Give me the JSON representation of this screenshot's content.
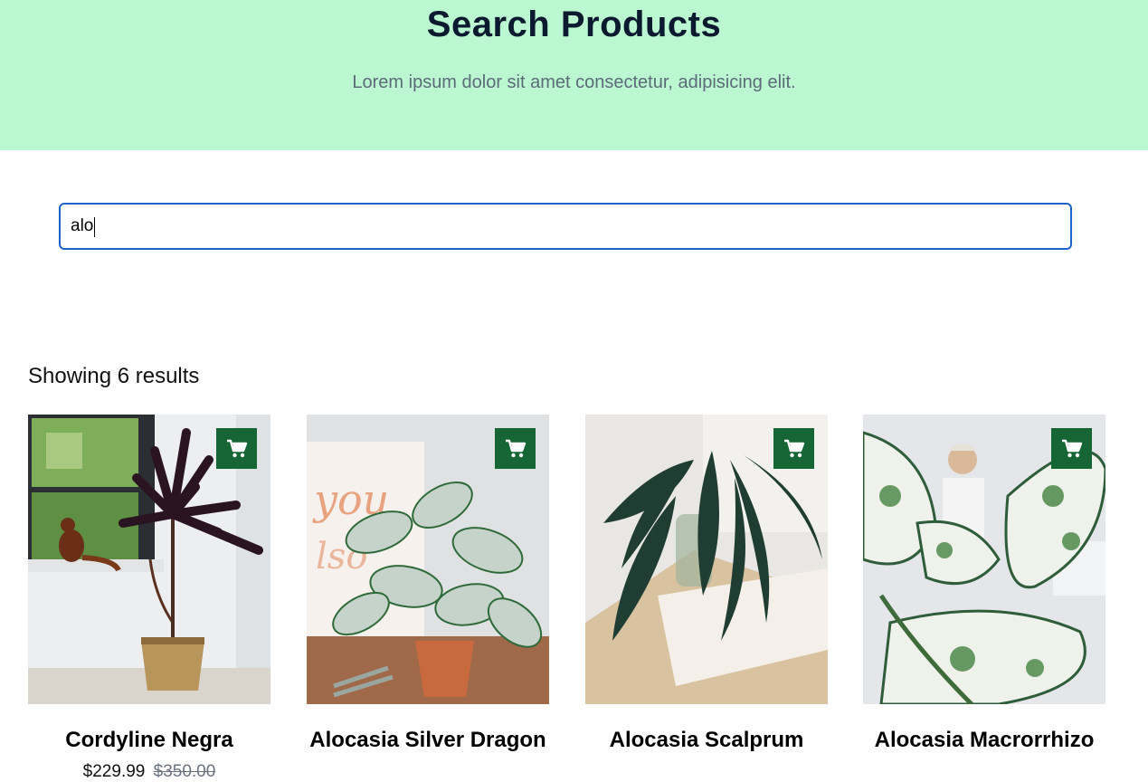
{
  "hero": {
    "title": "Search Products",
    "subtitle": "Lorem ipsum dolor sit amet consectetur, adipisicing elit."
  },
  "search": {
    "value": "alo"
  },
  "results": {
    "count_text": "Showing 6 results"
  },
  "colors": {
    "hero_bg": "#bbf7d0",
    "cart_button": "#166534",
    "search_border": "#1d63c7"
  },
  "products": [
    {
      "name": "Cordyline Negra",
      "price": "$229.99",
      "old_price": "$350.00",
      "icon": "cart-icon"
    },
    {
      "name": "Alocasia Silver Dragon",
      "icon": "cart-icon"
    },
    {
      "name": "Alocasia Scalprum",
      "icon": "cart-icon"
    },
    {
      "name": "Alocasia Macrorrhizo",
      "icon": "cart-icon"
    }
  ]
}
